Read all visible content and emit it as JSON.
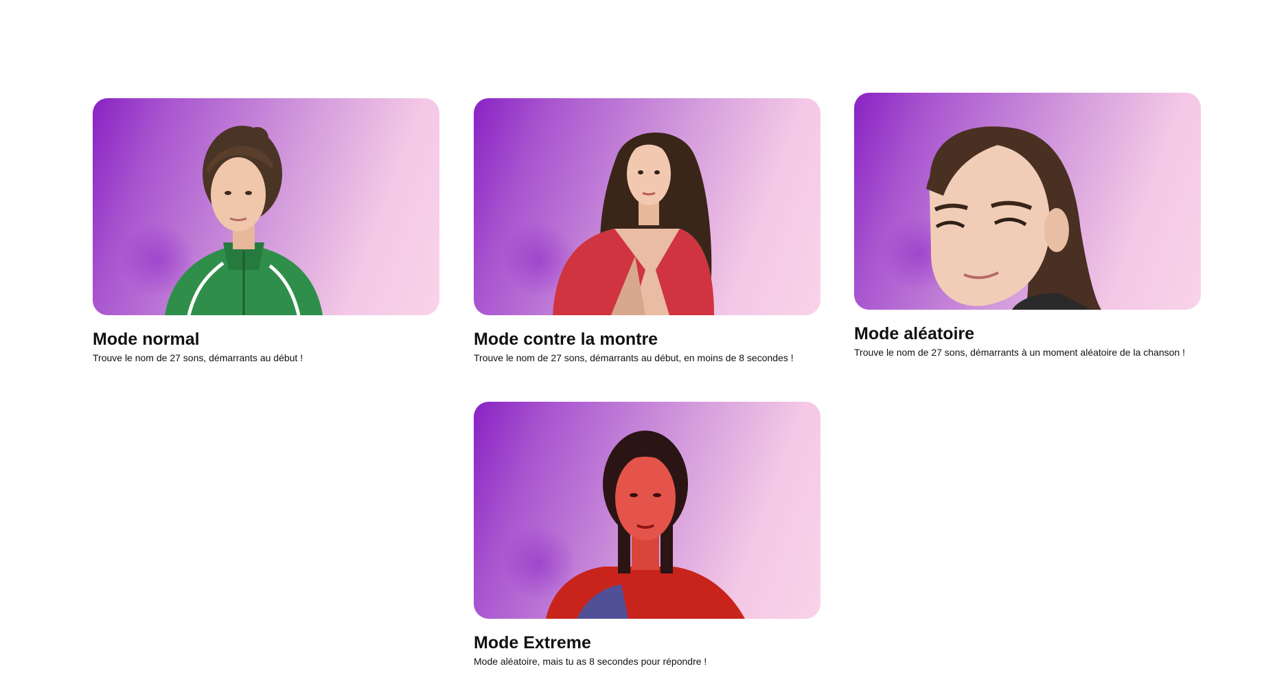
{
  "modes": [
    {
      "title": "Mode normal",
      "description": "Trouve le nom de 27 sons, démarrants au début !"
    },
    {
      "title": "Mode contre la montre",
      "description": "Trouve le nom de 27 sons, démarrants au début, en moins de 8 secondes !"
    },
    {
      "title": "Mode aléatoire",
      "description": "Trouve le nom de 27 sons, démarrants à un moment aléatoire de la chanson !"
    },
    {
      "title": "Mode Extreme",
      "description": "Mode aléatoire, mais tu as 8 secondes pour répondre !"
    }
  ],
  "colors": {
    "gradient_start": "#8a22c4",
    "gradient_end": "#f9d3ea",
    "text": "#111111"
  }
}
